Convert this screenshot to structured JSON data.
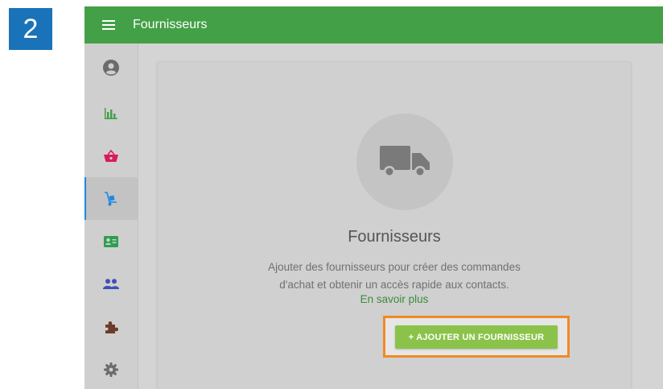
{
  "step_badge": "2",
  "header": {
    "title": "Fournisseurs"
  },
  "sidebar": {
    "items": [
      {
        "name": "account",
        "icon": "account-circle-icon",
        "active": false
      },
      {
        "name": "reports",
        "icon": "bar-chart-icon",
        "active": false
      },
      {
        "name": "sales",
        "icon": "basket-icon",
        "active": false
      },
      {
        "name": "inventory",
        "icon": "hand-truck-icon",
        "active": true
      },
      {
        "name": "customers",
        "icon": "contact-card-icon",
        "active": false
      },
      {
        "name": "employees",
        "icon": "people-icon",
        "active": false
      },
      {
        "name": "integrations",
        "icon": "puzzle-icon",
        "active": false
      },
      {
        "name": "settings",
        "icon": "gear-icon",
        "active": false
      }
    ]
  },
  "empty_state": {
    "icon": "truck-icon",
    "title": "Fournisseurs",
    "description_line1": "Ajouter des fournisseurs pour créer des commandes",
    "description_line2": "d'achat et obtenir un accès rapide aux contacts.",
    "learn_more": "En savoir plus",
    "add_button": "+ AJOUTER UN FOURNISSEUR"
  },
  "colors": {
    "topbar": "#43a047",
    "step_badge": "#1a73b8",
    "highlight": "#f08a24",
    "button": "#8bc34a",
    "link": "#3c8b3c"
  }
}
